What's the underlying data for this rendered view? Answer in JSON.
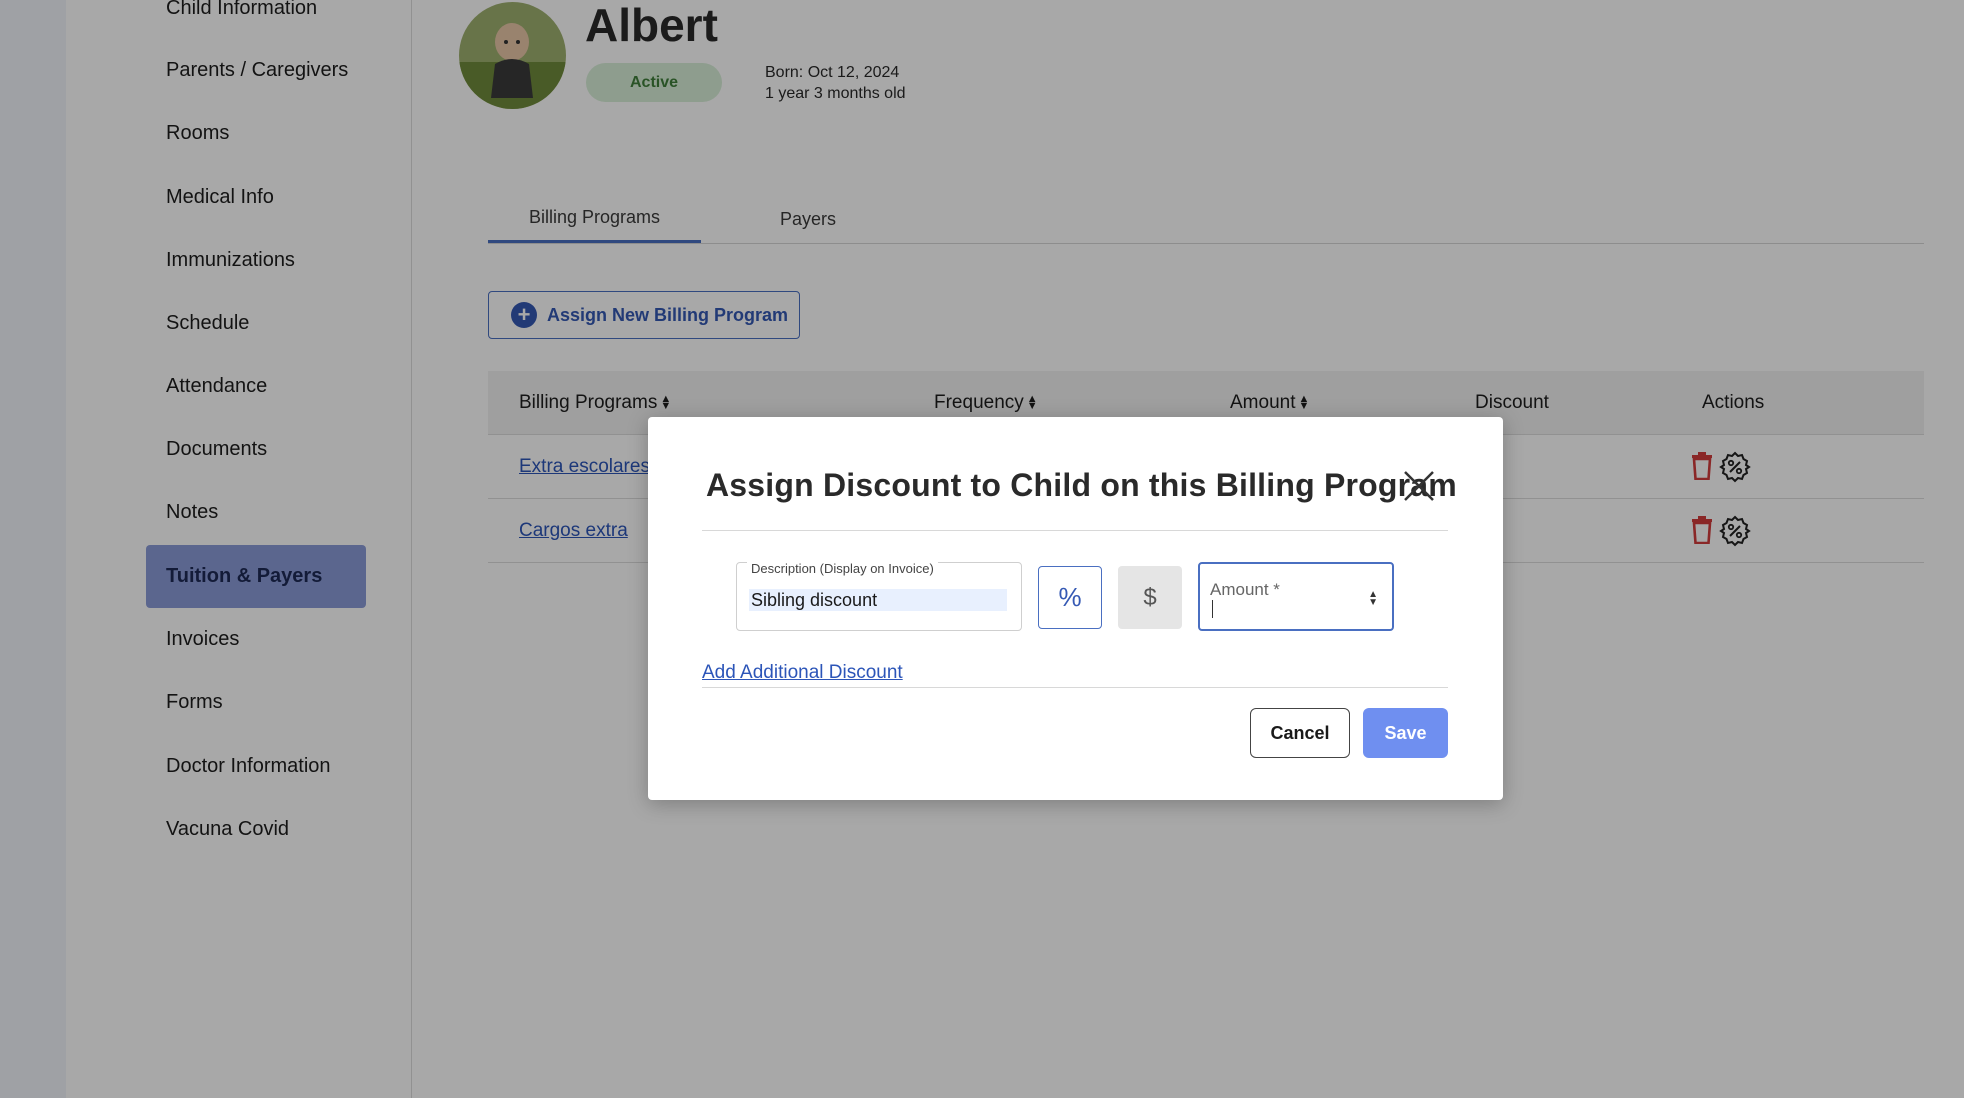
{
  "sidebar": {
    "items": [
      {
        "label": "Child Information"
      },
      {
        "label": "Parents / Caregivers"
      },
      {
        "label": "Rooms"
      },
      {
        "label": "Medical Info"
      },
      {
        "label": "Immunizations"
      },
      {
        "label": "Schedule"
      },
      {
        "label": "Attendance"
      },
      {
        "label": "Documents"
      },
      {
        "label": "Notes"
      },
      {
        "label": "Tuition & Payers",
        "active": true
      },
      {
        "label": "Invoices"
      },
      {
        "label": "Forms"
      },
      {
        "label": "Doctor Information"
      },
      {
        "label": "Vacuna Covid"
      }
    ]
  },
  "child": {
    "name": "Albert",
    "status": "Active",
    "born": "Born: Oct 12, 2024",
    "age": "1 year 3 months old"
  },
  "tabs": [
    {
      "label": "Billing Programs",
      "active": true
    },
    {
      "label": "Payers"
    }
  ],
  "assign_button": {
    "label": "Assign New Billing Program"
  },
  "table": {
    "headers": [
      "Billing Programs",
      "Frequency",
      "Amount",
      "Discount",
      "Actions"
    ],
    "rows": [
      {
        "program": "Extra escolares"
      },
      {
        "program": "Cargos extra"
      }
    ]
  },
  "modal": {
    "title": "Assign Discount to Child on this Billing Program",
    "description_label": "Description (Display on Invoice)",
    "description_value": "Sibling discount",
    "percent_symbol": "%",
    "dollar_symbol": "$",
    "amount_label": "Amount *",
    "add_discount_label": "Add Additional Discount",
    "cancel_label": "Cancel",
    "save_label": "Save"
  },
  "colors": {
    "accent": "#4a6fc1",
    "save_button": "#6f8ff0",
    "active_nav": "#8b9cd8",
    "status_pill": "#d8efd8",
    "link": "#2c55b8",
    "trash": "#d23c3c"
  }
}
